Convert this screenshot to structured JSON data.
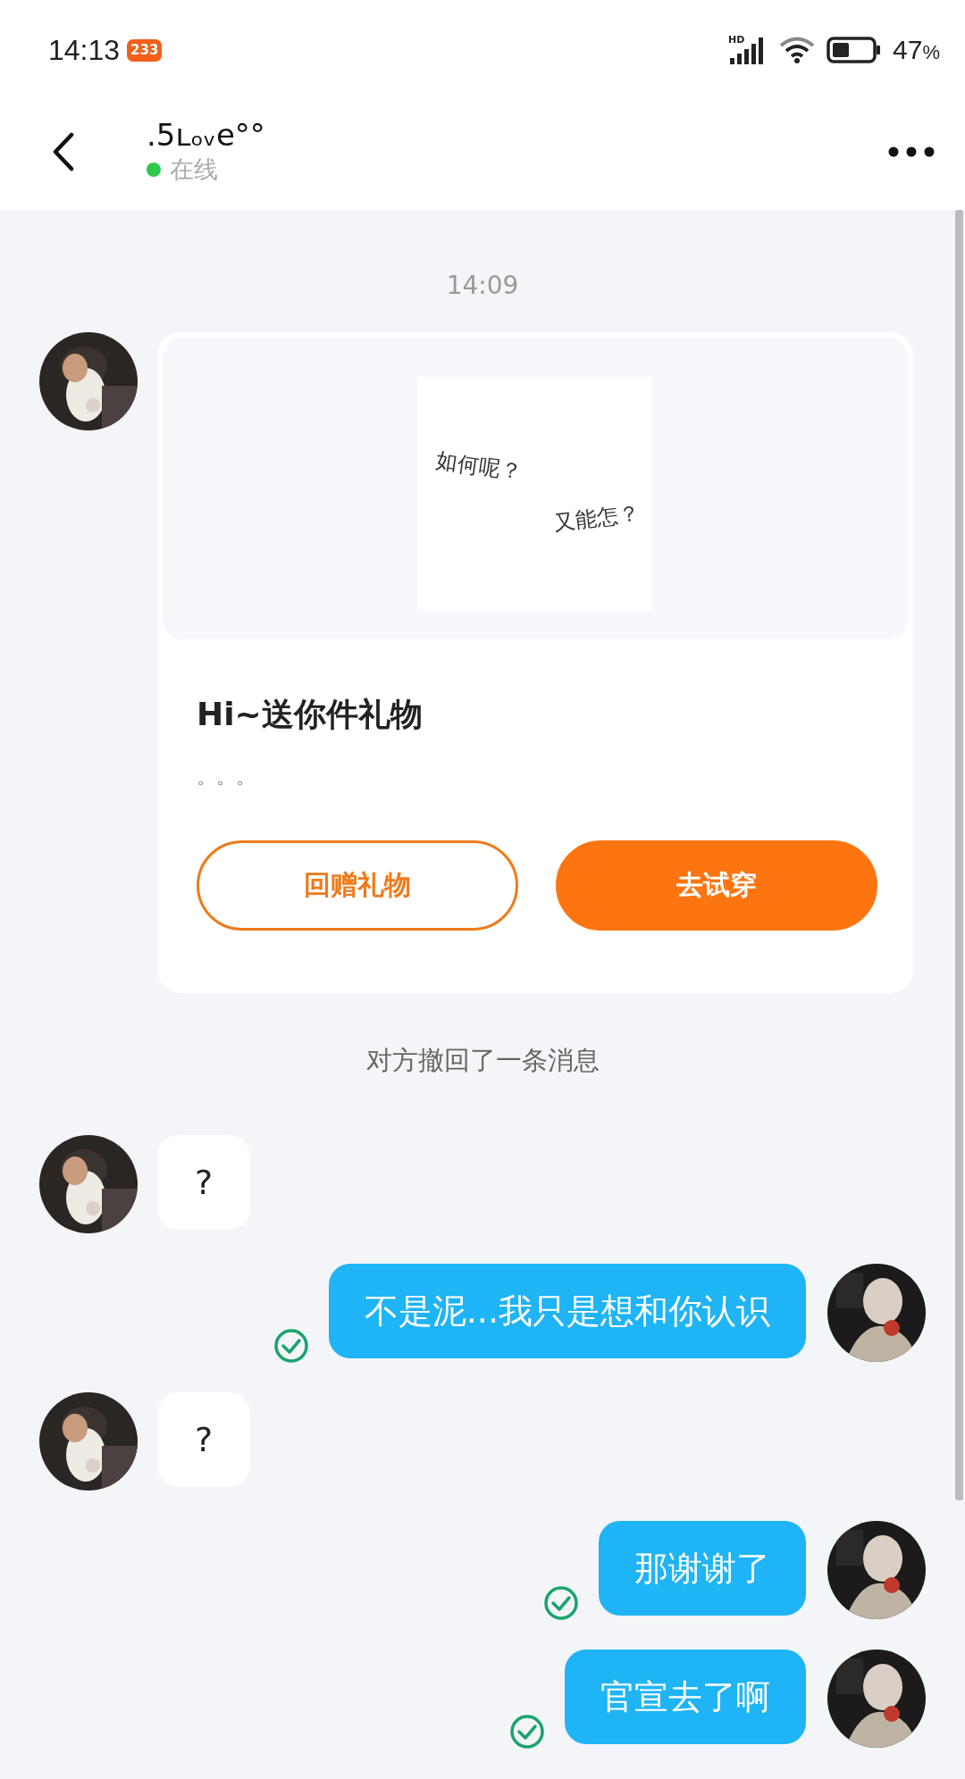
{
  "status_bar": {
    "time": "14:13",
    "app_badge": "233",
    "network_label": "HD",
    "battery": "47",
    "battery_unit": "%"
  },
  "header": {
    "name": ".5ʟₒᵥe°°",
    "presence": "在线",
    "online": true
  },
  "messages": [
    {
      "kind": "time",
      "text": "14:09"
    },
    {
      "kind": "gift",
      "image_lines": [
        "如何呢？",
        "又能怎？"
      ],
      "title": "Hi~送你件礼物",
      "text": "。。。",
      "buttons": [
        {
          "label": "回赠礼物",
          "primary": false
        },
        {
          "label": "去试穿",
          "primary": true
        }
      ]
    },
    {
      "kind": "notice",
      "text": "对方撤回了一条消息"
    },
    {
      "kind": "received",
      "text": "?"
    },
    {
      "kind": "sent",
      "text": "不是泥...我只是想和你认识",
      "read": true
    },
    {
      "kind": "received",
      "text": "?"
    },
    {
      "kind": "sent",
      "text": "那谢谢了",
      "read": true
    },
    {
      "kind": "sent",
      "text": "官宣去了啊",
      "read": true
    }
  ]
}
